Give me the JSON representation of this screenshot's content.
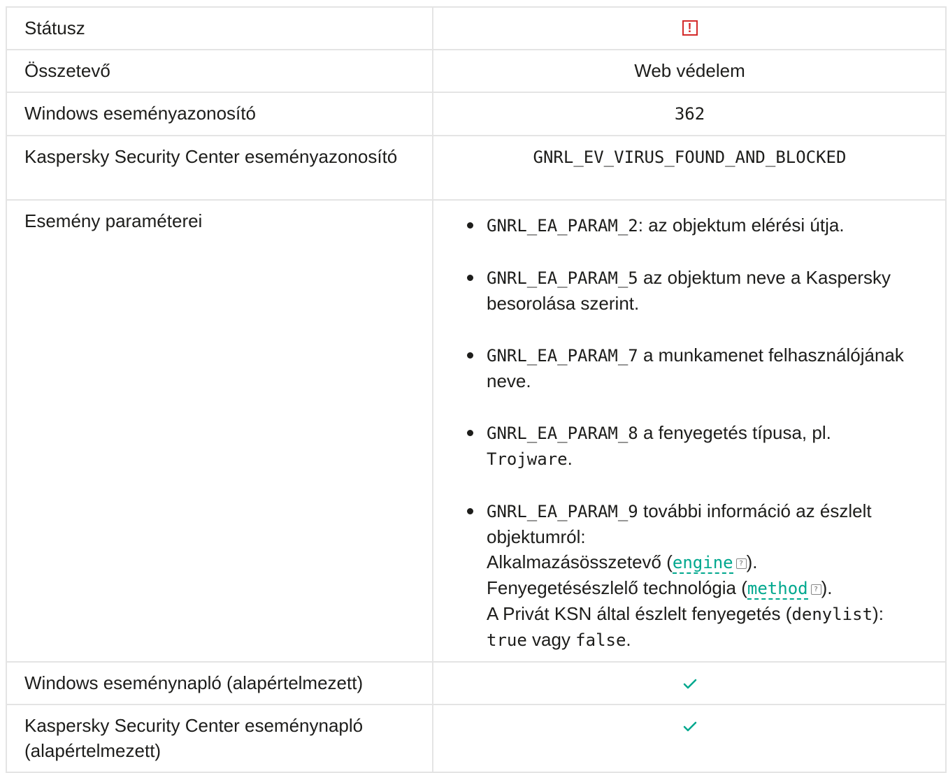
{
  "rows": {
    "status": {
      "label": "Státusz",
      "icon": "error-icon",
      "icon_glyph": "!"
    },
    "component": {
      "label": "Összetevő",
      "value": "Web védelem"
    },
    "windows_event_id": {
      "label": "Windows eseményazonosító",
      "value": "362"
    },
    "ksc_event_id": {
      "label": "Kaspersky Security Center eseményazonosító",
      "value": "GNRL_EV_VIRUS_FOUND_AND_BLOCKED"
    },
    "event_params": {
      "label": "Esemény paraméterei",
      "items": [
        {
          "code": "GNRL_EA_PARAM_2",
          "text": ": az objektum elérési útja."
        },
        {
          "code": "GNRL_EA_PARAM_5",
          "text": " az objektum neve a Kaspersky besorolása szerint."
        },
        {
          "code": "GNRL_EA_PARAM_7",
          "text": " a munkamenet felhasználójának neve."
        },
        {
          "code": "GNRL_EA_PARAM_8",
          "text": " a fenyegetés típusa, pl. ",
          "example": "Trojware",
          "end": "."
        },
        {
          "code": "GNRL_EA_PARAM_9",
          "text": " további információ az észlelt objektumról:",
          "line1_pre": "Alkalmazásösszetevő (",
          "line1_term": "engine",
          "line1_post": ").",
          "line2_pre": "Fenyegetésészlelő technológia (",
          "line2_term": "method",
          "line2_post": ").",
          "line3_pre": "A Privát KSN által észlelt fenyegetés (",
          "line3_code": "denylist",
          "line3_post": "):",
          "line4_true": "true",
          "line4_mid": " vagy ",
          "line4_false": "false",
          "line4_end": "."
        }
      ]
    },
    "windows_log": {
      "label": "Windows eseménynapló (alapértelmezett)",
      "icon": "checkmark-icon"
    },
    "ksc_log": {
      "label": "Kaspersky Security Center eseménynapló (alapértelmezett)",
      "icon": "checkmark-icon"
    }
  },
  "colors": {
    "error": "#d42a2a",
    "check": "#00a88e",
    "link": "#00a88e",
    "border": "#e4e4e4"
  },
  "help_glyph": "?"
}
